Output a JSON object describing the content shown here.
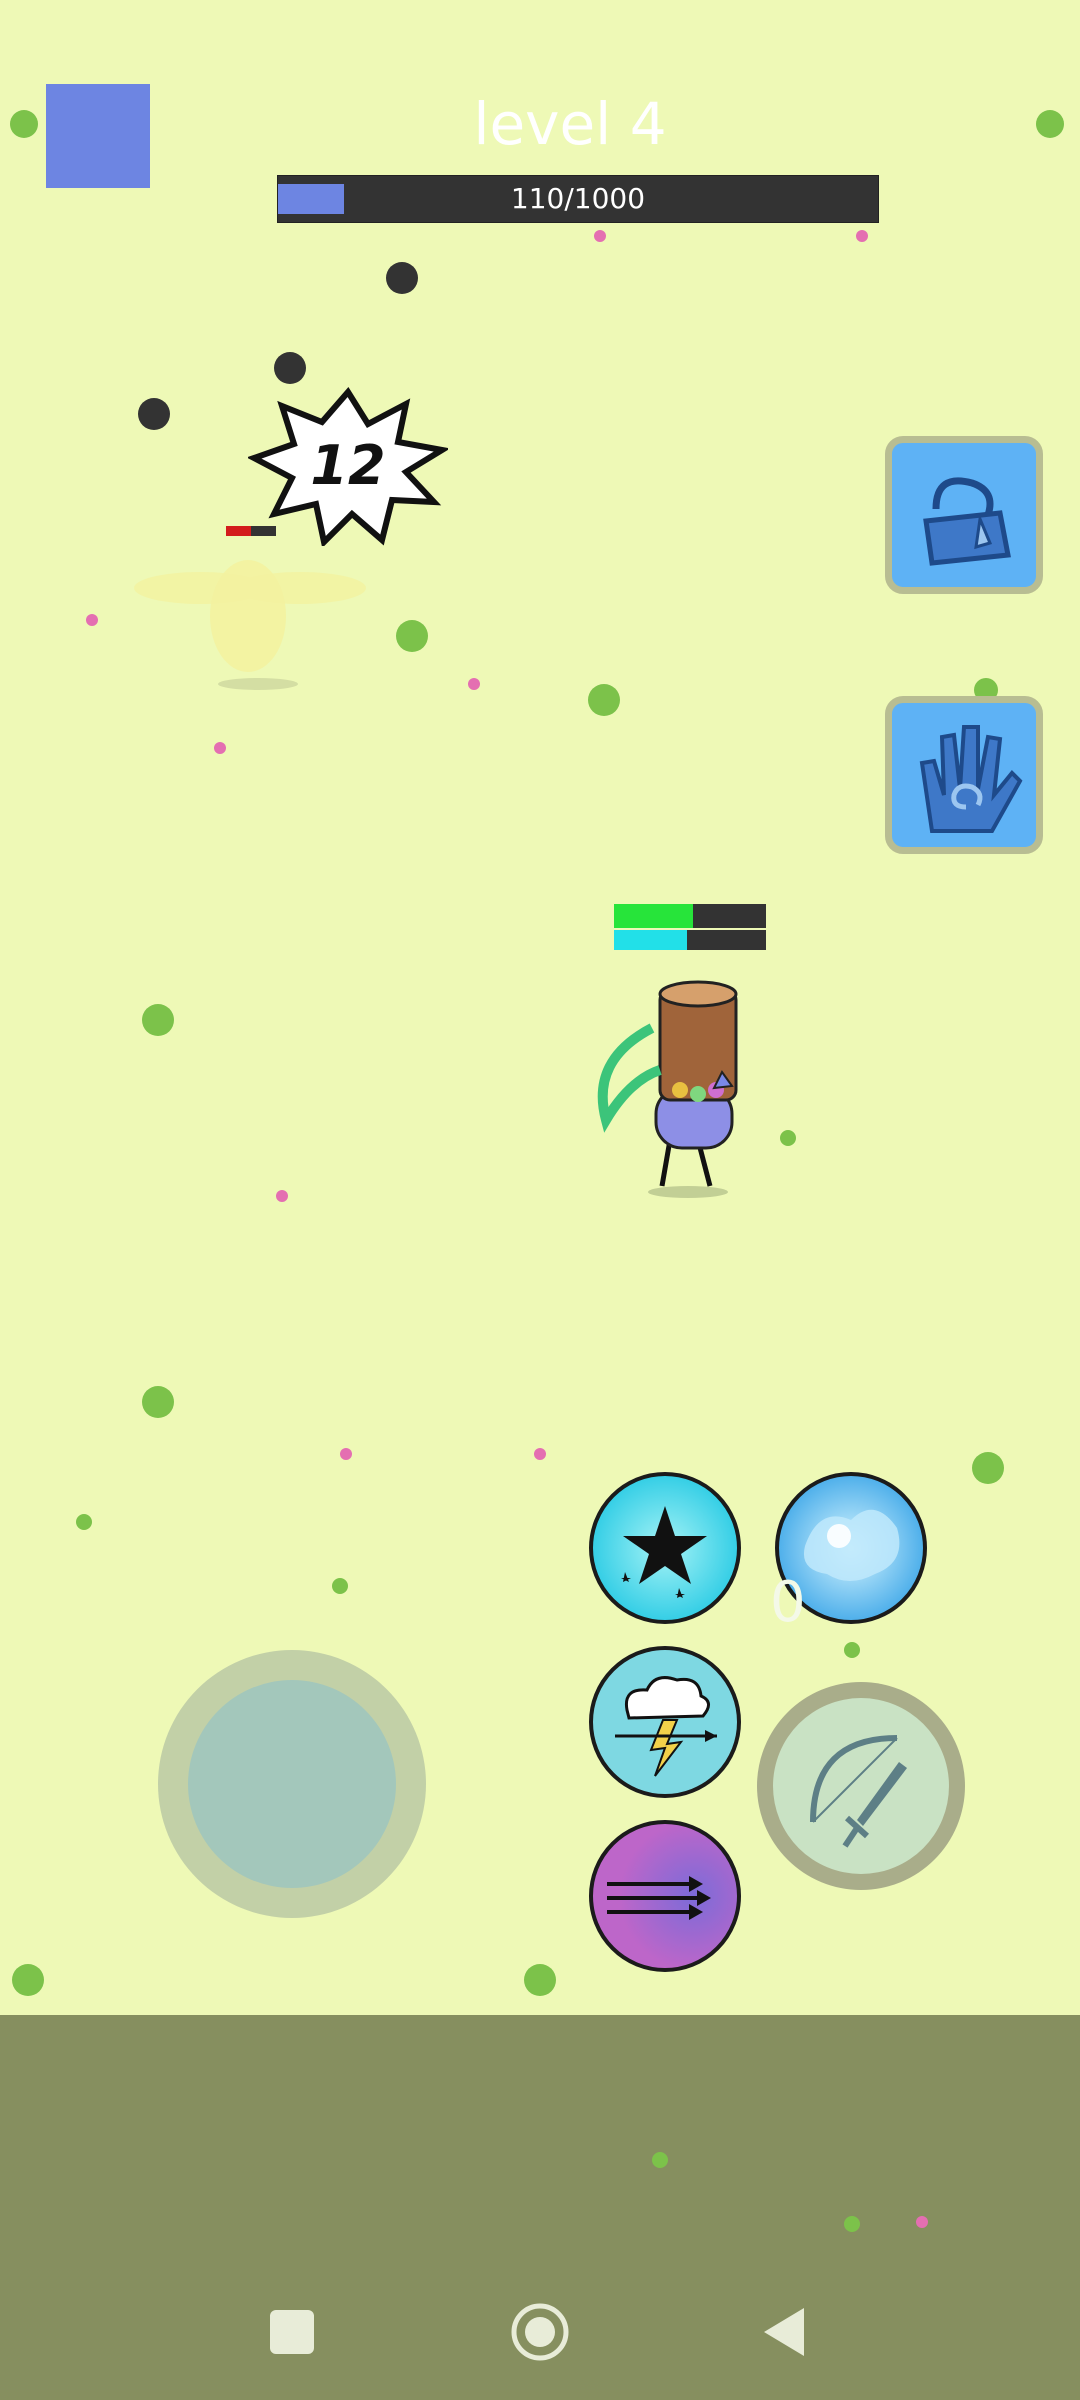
{
  "hud": {
    "level_text": "level 4",
    "xp_text": "110/1000",
    "xp_fraction": 0.11
  },
  "damage_popup": {
    "text": "12"
  },
  "ability_cooldown": {
    "text": "0"
  },
  "player": {
    "health_fraction": 0.52,
    "mana_fraction": 0.48
  },
  "enemy": {
    "health_fraction": 0.5
  },
  "icons": {
    "menu": "menu-square-icon",
    "inventory": "bag-icon",
    "spell": "hand-spiral-icon",
    "skill_1": "star-burst-icon",
    "skill_2": "water-splash-icon",
    "skill_3": "storm-arrow-icon",
    "skill_4": "multi-arrow-icon",
    "attack": "bow-sword-icon"
  },
  "colors": {
    "field": "#eef9b6",
    "accent_blue": "#6d85e2",
    "button_blue": "#5eb2f5",
    "hp_green": "#27e43a",
    "mana_cyan": "#22e0e8",
    "strip": "#868f5f"
  },
  "system_nav": {
    "recent": "recent-apps-icon",
    "home": "home-icon",
    "back": "back-icon"
  }
}
